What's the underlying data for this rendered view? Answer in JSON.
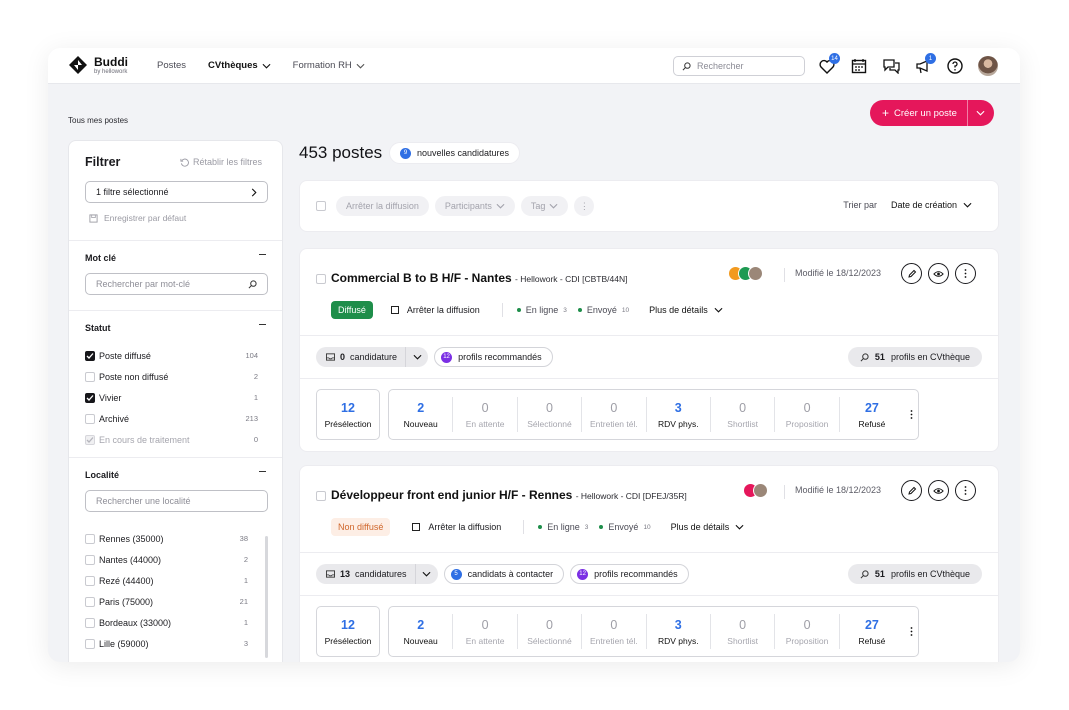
{
  "brand": {
    "name": "Buddi",
    "sub": "by hellowork"
  },
  "nav": [
    {
      "label": "Postes",
      "active": false,
      "dropdown": false
    },
    {
      "label": "CVthèques",
      "active": true,
      "dropdown": true
    },
    {
      "label": "Formation RH",
      "active": false,
      "dropdown": true
    }
  ],
  "search": {
    "placeholder": "Rechercher"
  },
  "top_icons": {
    "favorites_count": "14",
    "announce_count": "1"
  },
  "breadcrumb": "Tous mes postes",
  "create_button": "Créer un poste",
  "filter": {
    "title": "Filtrer",
    "reset": "Rétablir les filtres",
    "selected": "1 filtre sélectionné",
    "save_default": "Enregistrer par défaut",
    "keyword": {
      "title": "Mot clé",
      "placeholder": "Rechercher par mot-clé"
    },
    "status": {
      "title": "Statut",
      "items": [
        {
          "label": "Poste diffusé",
          "count": "104",
          "checked": true
        },
        {
          "label": "Poste non diffusé",
          "count": "2",
          "checked": false
        },
        {
          "label": "Vivier",
          "count": "1",
          "checked": true
        },
        {
          "label": "Archivé",
          "count": "213",
          "checked": false
        },
        {
          "label": "En cours de traitement",
          "count": "0",
          "checked": true,
          "disabled": true
        }
      ]
    },
    "locality": {
      "title": "Localité",
      "placeholder": "Rechercher une localité",
      "items": [
        {
          "label": "Rennes (35000)",
          "count": "38"
        },
        {
          "label": "Nantes (44000)",
          "count": "2"
        },
        {
          "label": "Rezé (44400)",
          "count": "1"
        },
        {
          "label": "Paris (75000)",
          "count": "21"
        },
        {
          "label": "Bordeaux (33000)",
          "count": "1"
        },
        {
          "label": "Lille (59000)",
          "count": "3"
        }
      ]
    }
  },
  "results": {
    "count_label": "453 postes",
    "new_count": "9",
    "new_label": "nouvelles candidatures"
  },
  "toolbar": {
    "stop": "Arrêter la diffusion",
    "participants": "Participants",
    "tag": "Tag",
    "more": "⋮",
    "sort_label": "Trier par",
    "sort_value": "Date de création"
  },
  "jobs": [
    {
      "title": "Commercial B to B H/F - Nantes",
      "subtitle": "- Hellowork - CDI [CBTB/44N]",
      "modified": "Modifié le 18/12/2023",
      "status": "Diffusé",
      "stop": "Arrêter la diffusion",
      "online": "En ligne",
      "online_n": "3",
      "sent": "Envoyé",
      "sent_n": "10",
      "details": "Plus de détails",
      "candidates_n": "0",
      "candidates_label": "candidature",
      "recommended_n": "12",
      "recommended_label": "profils recommandés",
      "cv_n": "51",
      "cv_label": "profils en CVthèque",
      "preselection": {
        "value": "12",
        "label": "Présélection"
      },
      "stages": [
        {
          "value": "2",
          "label": "Nouveau",
          "active": true
        },
        {
          "value": "0",
          "label": "En attente",
          "active": false
        },
        {
          "value": "0",
          "label": "Sélectionné",
          "active": false
        },
        {
          "value": "0",
          "label": "Entretien tél.",
          "active": false
        },
        {
          "value": "3",
          "label": "RDV phys.",
          "active": true
        },
        {
          "value": "0",
          "label": "Shortlist",
          "active": false
        },
        {
          "value": "0",
          "label": "Proposition",
          "active": false
        },
        {
          "value": "27",
          "label": "Refusé",
          "active": true
        }
      ]
    },
    {
      "title": "Développeur front end junior H/F - Rennes",
      "subtitle": "- Hellowork - CDI [DFEJ/35R]",
      "modified": "Modifié le 18/12/2023",
      "status": "Non diffusé",
      "stop": "Arrêter la diffusion",
      "online": "En ligne",
      "online_n": "3",
      "sent": "Envoyé",
      "sent_n": "10",
      "details": "Plus de détails",
      "candidates_n": "13",
      "candidates_label": "candidatures",
      "contact_n": "5",
      "contact_label": "candidats à contacter",
      "recommended_n": "12",
      "recommended_label": "profils recommandés",
      "cv_n": "51",
      "cv_label": "profils en CVthèque",
      "preselection": {
        "value": "12",
        "label": "Présélection"
      },
      "stages": [
        {
          "value": "2",
          "label": "Nouveau",
          "active": true
        },
        {
          "value": "0",
          "label": "En attente",
          "active": false
        },
        {
          "value": "0",
          "label": "Sélectionné",
          "active": false
        },
        {
          "value": "0",
          "label": "Entretien tél.",
          "active": false
        },
        {
          "value": "3",
          "label": "RDV phys.",
          "active": true
        },
        {
          "value": "0",
          "label": "Shortlist",
          "active": false
        },
        {
          "value": "0",
          "label": "Proposition",
          "active": false
        },
        {
          "value": "27",
          "label": "Refusé",
          "active": true
        }
      ]
    }
  ],
  "colors": {
    "accent": "#e5175b",
    "blue": "#2f6fe4",
    "green": "#1e8e4a",
    "purple": "#7b2fe4"
  }
}
